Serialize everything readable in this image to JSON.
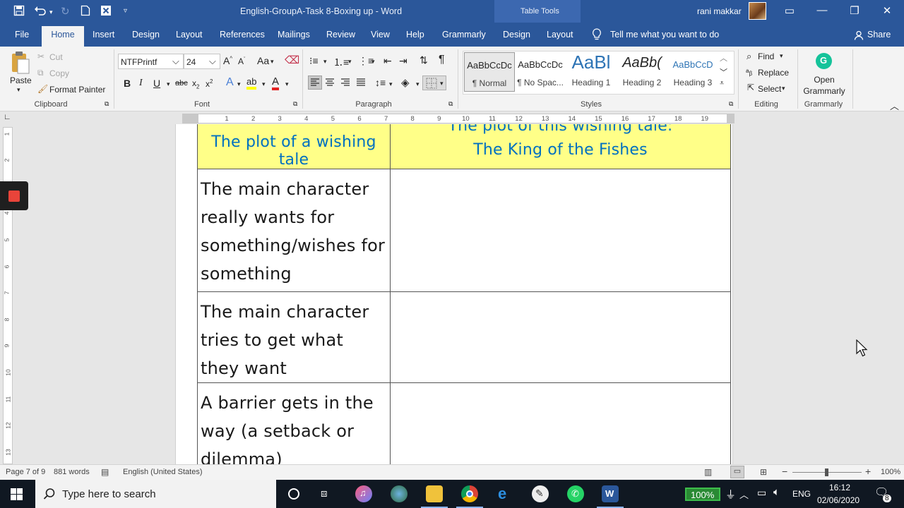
{
  "app": {
    "document_title": "English-GroupA-Task 8-Boxing up  -  Word",
    "context_group": "Table Tools",
    "user_name": "rani makkar"
  },
  "tabs": [
    "File",
    "Home",
    "Insert",
    "Design",
    "Layout",
    "References",
    "Mailings",
    "Review",
    "View",
    "Help",
    "Grammarly",
    "Design",
    "Layout"
  ],
  "tell_me": "Tell me what you want to do",
  "share": "Share",
  "ribbon": {
    "clipboard": {
      "paste": "Paste",
      "cut": "Cut",
      "copy": "Copy",
      "format_painter": "Format Painter",
      "label": "Clipboard"
    },
    "font": {
      "name": "NTFPrintf",
      "size": "24",
      "label": "Font",
      "change_case": "Aa"
    },
    "paragraph": {
      "label": "Paragraph"
    },
    "styles": {
      "label": "Styles",
      "items": [
        {
          "sample": "AaBbCcDc",
          "name": "¶ Normal"
        },
        {
          "sample": "AaBbCcDc",
          "name": "¶ No Spac..."
        },
        {
          "sample": "AaBl",
          "name": "Heading 1"
        },
        {
          "sample": "AaBb(",
          "name": "Heading 2"
        },
        {
          "sample": "AaBbCcD",
          "name": "Heading 3"
        }
      ]
    },
    "editing": {
      "find": "Find",
      "replace": "Replace",
      "select": "Select",
      "label": "Editing"
    },
    "grammarly": {
      "open": "Open Grammarly",
      "label": "Grammarly"
    }
  },
  "ruler": {
    "numbers": [
      "1",
      "2",
      "3",
      "4",
      "5",
      "6",
      "7",
      "8",
      "9",
      "10",
      "11",
      "12",
      "13",
      "14",
      "15",
      "16",
      "17",
      "18",
      "19"
    ]
  },
  "document": {
    "header_left": "The plot of a wishing tale",
    "header_right_line1": "The plot of this wishing tale:",
    "header_right_line2": "The King of the Fishes",
    "rows": [
      {
        "left": "The main character really wants for something/wishes for something",
        "right": ""
      },
      {
        "left": "The main character tries to get what they want",
        "right": ""
      },
      {
        "left": "A barrier gets in the way (a setback or dilemma)",
        "right": ""
      }
    ]
  },
  "status": {
    "page": "Page 7 of 9",
    "words": "881 words",
    "language": "English (United States)",
    "zoom": "100%"
  },
  "taskbar": {
    "search_placeholder": "Type here to search",
    "battery": "100%",
    "input_lang": "ENG",
    "time": "16:12",
    "date": "02/06/2020",
    "notifications": "8"
  }
}
